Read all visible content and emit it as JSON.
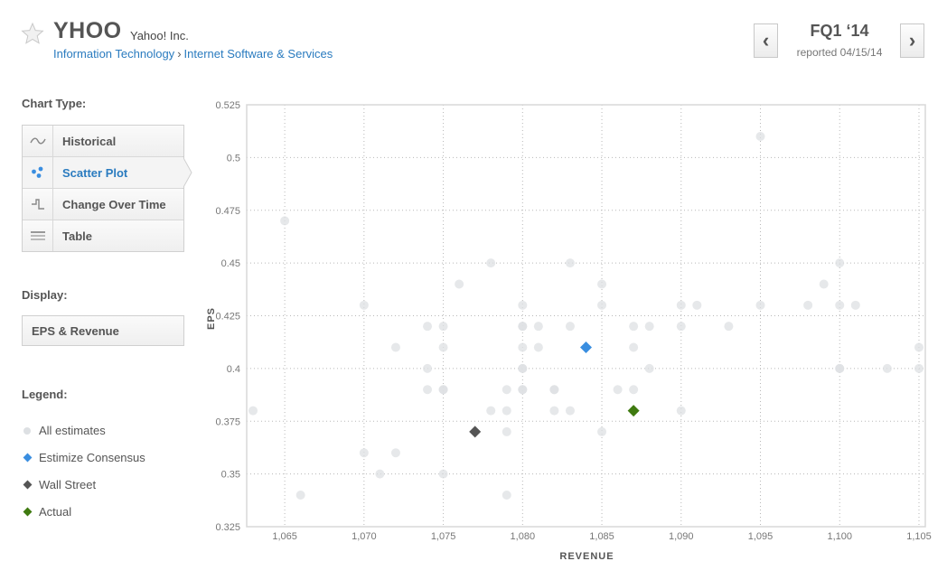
{
  "header": {
    "ticker": "YHOO",
    "company": "Yahoo! Inc.",
    "breadcrumb": [
      "Information Technology",
      "Internet Software & Services"
    ],
    "breadcrumb_separator": "›",
    "period": "FQ1 ‘14",
    "reported": "reported 04/15/14",
    "prev_icon": "‹",
    "next_icon": "›"
  },
  "sidebar": {
    "chart_type_label": "Chart Type:",
    "chart_types": [
      {
        "label": "Historical",
        "icon": "wave-icon",
        "active": false
      },
      {
        "label": "Scatter Plot",
        "icon": "scatter-icon",
        "active": true
      },
      {
        "label": "Change Over Time",
        "icon": "step-icon",
        "active": false
      },
      {
        "label": "Table",
        "icon": "table-icon",
        "active": false
      }
    ],
    "display_label": "Display:",
    "display_value": "EPS & Revenue",
    "legend_label": "Legend:",
    "legend": [
      {
        "label": "All estimates",
        "shape": "circle",
        "color": "#dde0e3"
      },
      {
        "label": "Estimize Consensus",
        "shape": "diamond",
        "color": "#3a8ee0"
      },
      {
        "label": "Wall Street",
        "shape": "diamond",
        "color": "#555555"
      },
      {
        "label": "Actual",
        "shape": "diamond",
        "color": "#3f7a10"
      }
    ]
  },
  "colors": {
    "accent": "#2a7bbf",
    "estimate": "#dde0e3",
    "consensus": "#3a8ee0",
    "wallstreet": "#555555",
    "actual": "#3f7a10",
    "grid": "#b8b8b8"
  },
  "chart_data": {
    "type": "scatter",
    "title": "",
    "xlabel": "REVENUE",
    "ylabel": "EPS",
    "xlim": [
      1062.6,
      1105.4
    ],
    "ylim": [
      0.325,
      0.525
    ],
    "x_ticks": [
      1065,
      1070,
      1075,
      1080,
      1085,
      1090,
      1095,
      1100,
      1105
    ],
    "x_tick_labels": [
      "1,065",
      "1,070",
      "1,075",
      "1,080",
      "1,085",
      "1,090",
      "1,095",
      "1,100",
      "1,105"
    ],
    "y_ticks": [
      0.325,
      0.35,
      0.375,
      0.4,
      0.425,
      0.45,
      0.475,
      0.5,
      0.525
    ],
    "y_tick_labels": [
      "0.325",
      "0.35",
      "0.375",
      "0.4",
      "0.425",
      "0.45",
      "0.475",
      "0.5",
      "0.525"
    ],
    "grid": true,
    "series": [
      {
        "name": "All estimates",
        "shape": "circle",
        "points": [
          [
            1095,
            0.51
          ],
          [
            1065,
            0.47
          ],
          [
            1078,
            0.45
          ],
          [
            1083,
            0.45
          ],
          [
            1100,
            0.45
          ],
          [
            1076,
            0.44
          ],
          [
            1085,
            0.44
          ],
          [
            1099,
            0.44
          ],
          [
            1070,
            0.43
          ],
          [
            1080,
            0.43
          ],
          [
            1085,
            0.43
          ],
          [
            1090,
            0.43
          ],
          [
            1091,
            0.43
          ],
          [
            1095,
            0.43
          ],
          [
            1098,
            0.43
          ],
          [
            1100,
            0.43
          ],
          [
            1101,
            0.43
          ],
          [
            1074,
            0.42
          ],
          [
            1075,
            0.42
          ],
          [
            1080,
            0.42
          ],
          [
            1080,
            0.42
          ],
          [
            1081,
            0.42
          ],
          [
            1083,
            0.42
          ],
          [
            1087,
            0.42
          ],
          [
            1088,
            0.42
          ],
          [
            1090,
            0.42
          ],
          [
            1093,
            0.42
          ],
          [
            1072,
            0.41
          ],
          [
            1075,
            0.41
          ],
          [
            1080,
            0.41
          ],
          [
            1081,
            0.41
          ],
          [
            1087,
            0.41
          ],
          [
            1105,
            0.41
          ],
          [
            1074,
            0.4
          ],
          [
            1080,
            0.4
          ],
          [
            1080,
            0.4
          ],
          [
            1088,
            0.4
          ],
          [
            1100,
            0.4
          ],
          [
            1100,
            0.4
          ],
          [
            1103,
            0.4
          ],
          [
            1105,
            0.4
          ],
          [
            1074,
            0.39
          ],
          [
            1075,
            0.39
          ],
          [
            1075,
            0.39
          ],
          [
            1079,
            0.39
          ],
          [
            1080,
            0.39
          ],
          [
            1080,
            0.39
          ],
          [
            1082,
            0.39
          ],
          [
            1082,
            0.39
          ],
          [
            1086,
            0.39
          ],
          [
            1087,
            0.39
          ],
          [
            1063,
            0.38
          ],
          [
            1078,
            0.38
          ],
          [
            1079,
            0.38
          ],
          [
            1082,
            0.38
          ],
          [
            1083,
            0.38
          ],
          [
            1090,
            0.38
          ],
          [
            1079,
            0.37
          ],
          [
            1085,
            0.37
          ],
          [
            1070,
            0.36
          ],
          [
            1072,
            0.36
          ],
          [
            1071,
            0.35
          ],
          [
            1075,
            0.35
          ],
          [
            1066,
            0.34
          ],
          [
            1079,
            0.34
          ]
        ]
      },
      {
        "name": "Estimize Consensus",
        "shape": "diamond",
        "points": [
          [
            1084,
            0.41
          ]
        ]
      },
      {
        "name": "Wall Street",
        "shape": "diamond",
        "points": [
          [
            1077,
            0.37
          ]
        ]
      },
      {
        "name": "Actual",
        "shape": "diamond",
        "points": [
          [
            1087,
            0.38
          ]
        ]
      }
    ]
  }
}
